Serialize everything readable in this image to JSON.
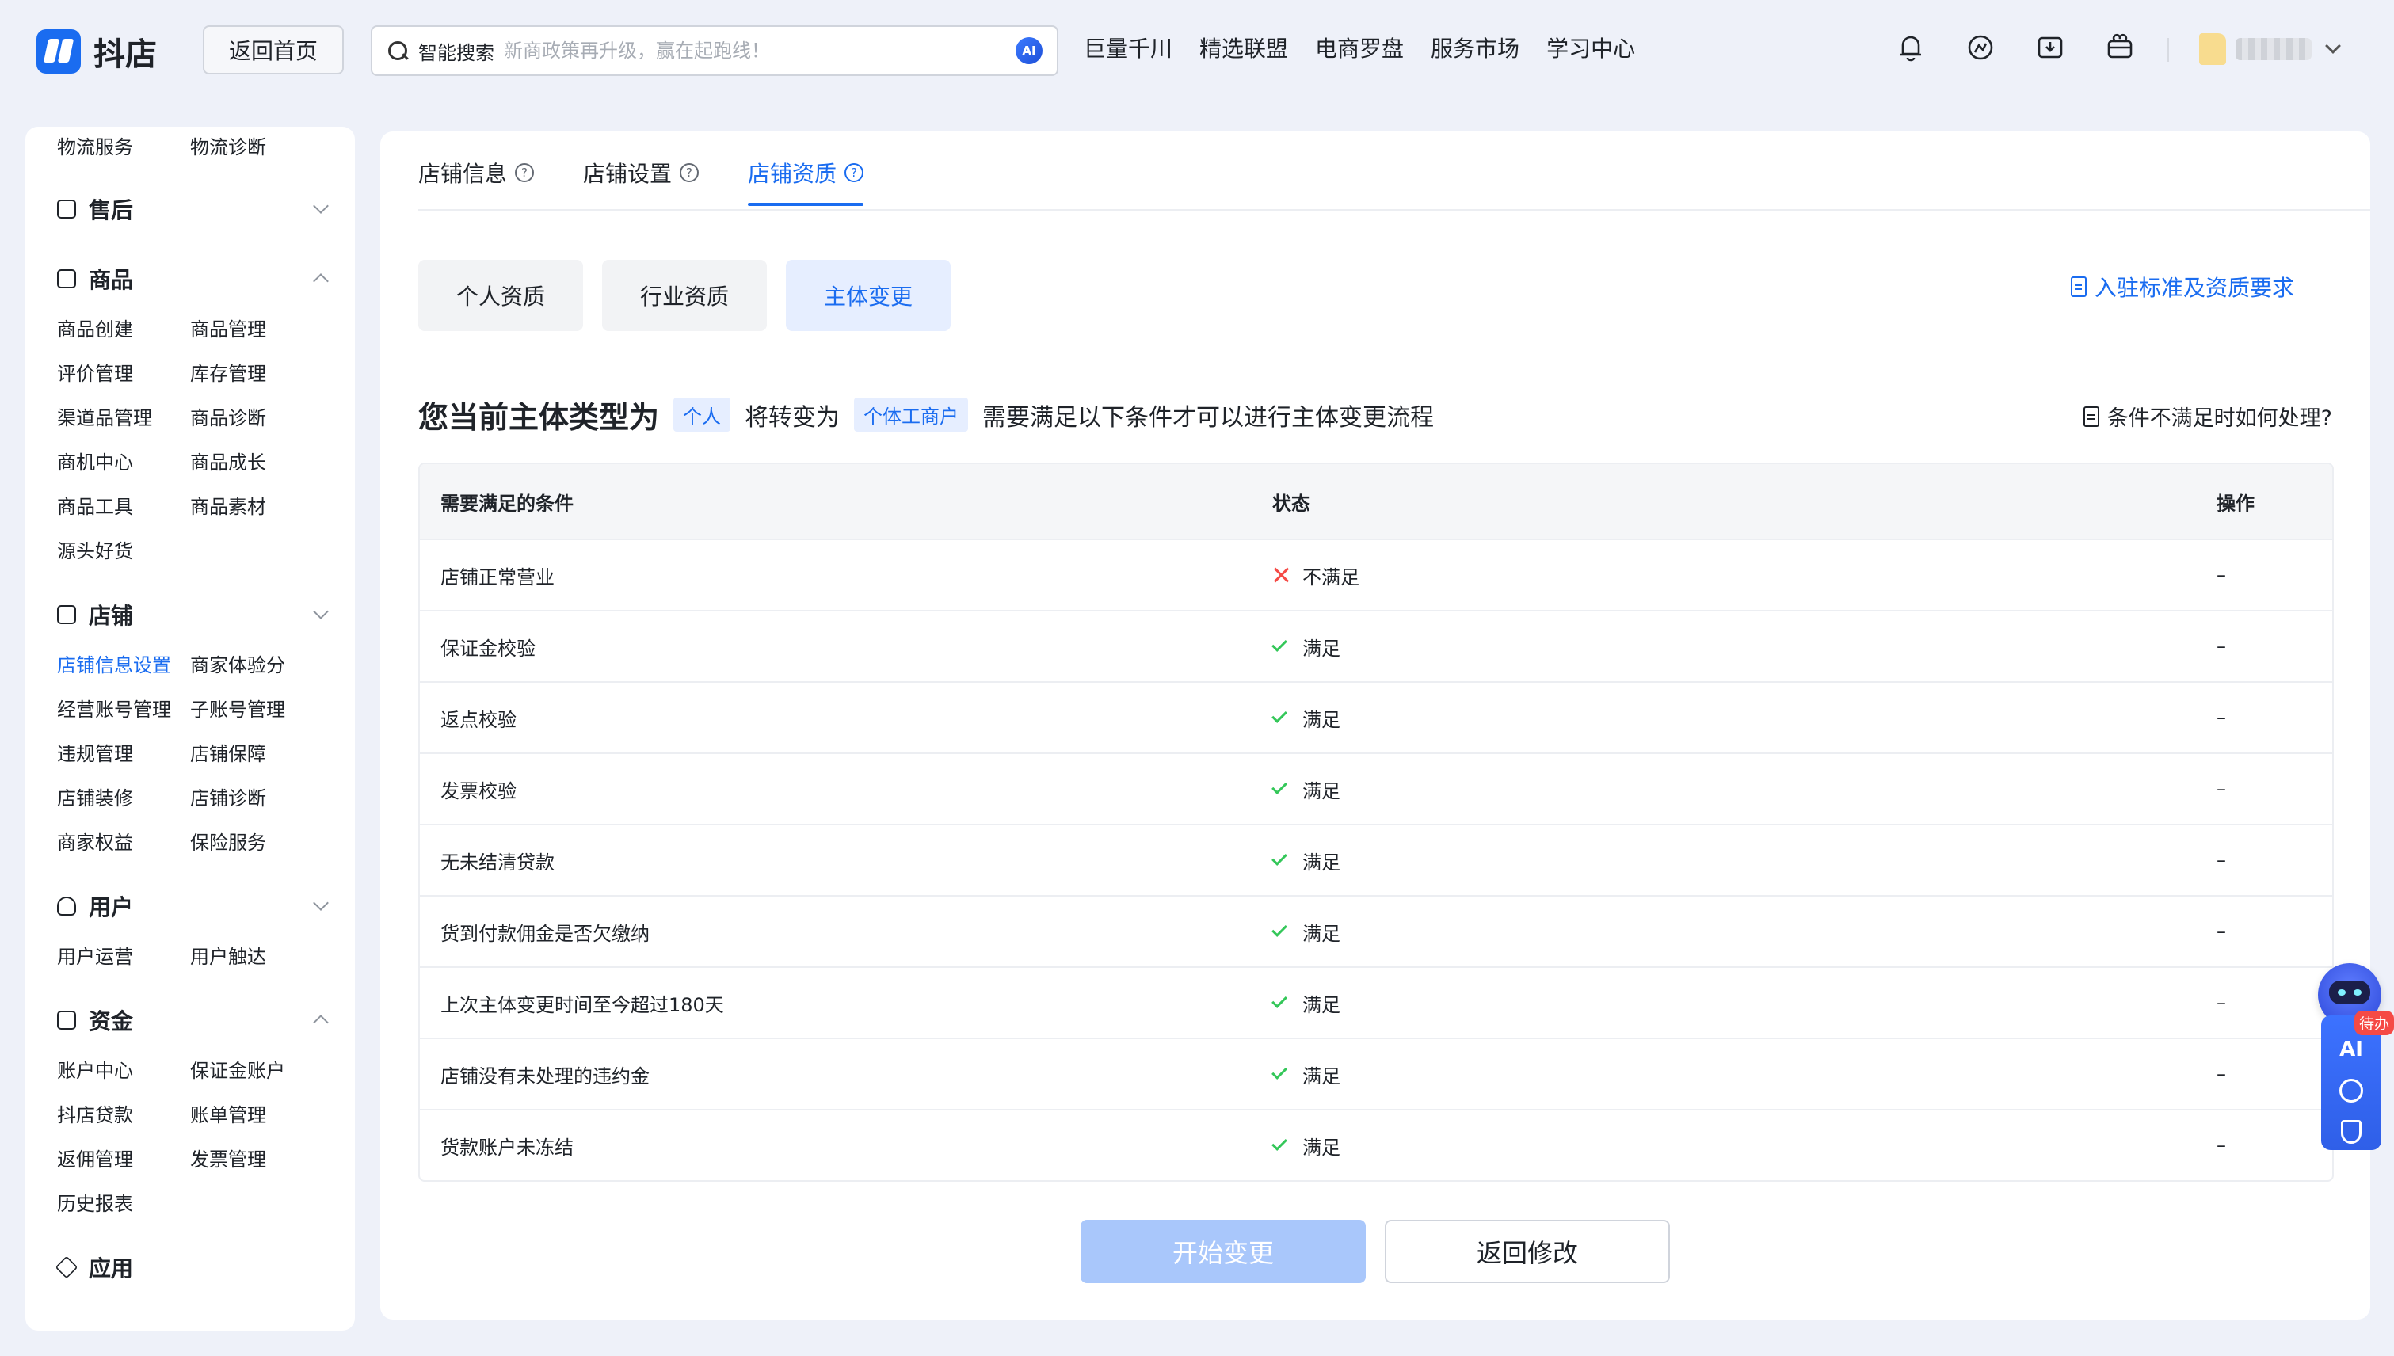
{
  "brand": {
    "name": "抖店"
  },
  "header": {
    "home_button": "返回首页",
    "search_label": "智能搜索",
    "search_placeholder": "新商政策再升级，赢在起跑线！",
    "ai_badge": "AI",
    "nav": [
      "巨量千川",
      "精选联盟",
      "电商罗盘",
      "服务市场",
      "学习中心"
    ],
    "icons": [
      "bell-icon",
      "support-icon",
      "download-icon",
      "gift-box-icon"
    ]
  },
  "sidebar": {
    "top_items": [
      "物流服务",
      "物流诊断"
    ],
    "groups": {
      "after_sales": {
        "title": "售后"
      },
      "goods": {
        "title": "商品",
        "items": [
          "商品创建",
          "商品管理",
          "评价管理",
          "库存管理",
          "渠道品管理",
          "商品诊断",
          "商机中心",
          "商品成长",
          "商品工具",
          "商品素材",
          "源头好货"
        ]
      },
      "shop": {
        "title": "店铺",
        "items": [
          "店铺信息设置",
          "商家体验分",
          "经营账号管理",
          "子账号管理",
          "违规管理",
          "店铺保障",
          "店铺装修",
          "店铺诊断",
          "商家权益",
          "保险服务"
        ]
      },
      "user": {
        "title": "用户",
        "items": [
          "用户运营",
          "用户触达"
        ]
      },
      "fund": {
        "title": "资金",
        "items": [
          "账户中心",
          "保证金账户",
          "抖店贷款",
          "账单管理",
          "返佣管理",
          "发票管理",
          "历史报表"
        ]
      },
      "app": {
        "title": "应用"
      }
    }
  },
  "main": {
    "tabs": [
      {
        "label": "店铺信息"
      },
      {
        "label": "店铺设置"
      },
      {
        "label": "店铺资质"
      }
    ],
    "subtabs": [
      "个人资质",
      "行业资质",
      "主体变更"
    ],
    "requirements_link": "入驻标准及资质要求",
    "heading": {
      "prefix": "您当前主体类型为",
      "current_type": "个人",
      "middle": "将转变为",
      "target_type": "个体工商户",
      "suffix": "需要满足以下条件才可以进行主体变更流程"
    },
    "help_link": "条件不满足时如何处理?",
    "table": {
      "columns": [
        "需要满足的条件",
        "状态",
        "操作"
      ],
      "rows": [
        {
          "condition": "店铺正常营业",
          "status": "不满足",
          "action": "–"
        },
        {
          "condition": "保证金校验",
          "status": "满足",
          "action": "–"
        },
        {
          "condition": "返点校验",
          "status": "满足",
          "action": "–"
        },
        {
          "condition": "发票校验",
          "status": "满足",
          "action": "–"
        },
        {
          "condition": "无未结清贷款",
          "status": "满足",
          "action": "–"
        },
        {
          "condition": "货到付款佣金是否欠缴纳",
          "status": "满足",
          "action": "–"
        },
        {
          "condition": "上次主体变更时间至今超过180天",
          "status": "满足",
          "action": "–"
        },
        {
          "condition": "店铺没有未处理的违约金",
          "status": "满足",
          "action": "–"
        },
        {
          "condition": "货款账户未冻结",
          "status": "满足",
          "action": "–"
        }
      ]
    },
    "start_button": "开始变更",
    "back_button": "返回修改"
  },
  "floating": {
    "ai_label": "AI",
    "todo_badge": "待办"
  },
  "colors": {
    "accent": "#1a6cf0",
    "success": "#34c759",
    "error": "#f54a45"
  }
}
